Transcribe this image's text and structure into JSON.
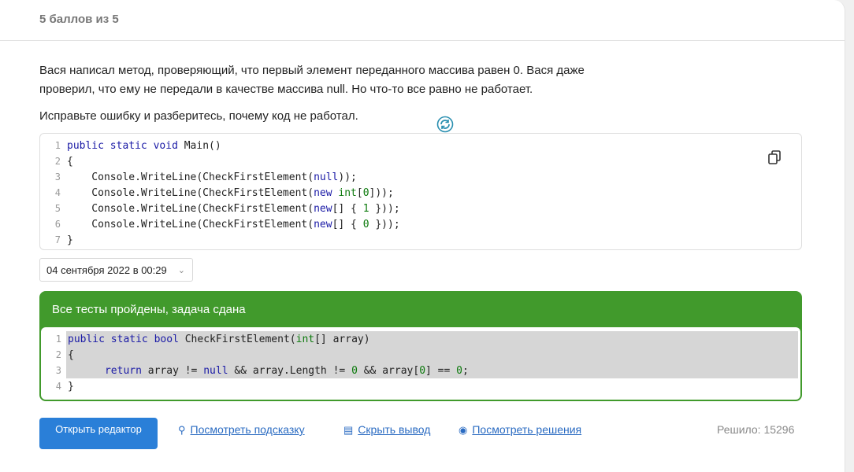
{
  "score": "5 баллов из 5",
  "task": {
    "paragraph1": "Вася написал метод, проверяющий, что первый элемент переданного массива равен 0. Вася даже проверил, что ему не передали в качестве массива null. Но что-то все равно не работает.",
    "paragraph2": "Исправьте ошибку и разберитесь, почему код не работал."
  },
  "code": {
    "line_numbers": [
      "1",
      "2",
      "3",
      "4",
      "5",
      "6",
      "7"
    ],
    "lines": [
      "public static void Main()",
      "{",
      "    Console.WriteLine(CheckFirstElement(null));",
      "    Console.WriteLine(CheckFirstElement(new int[0]));",
      "    Console.WriteLine(CheckFirstElement(new[] { 1 }));",
      "    Console.WriteLine(CheckFirstElement(new[] { 0 }));",
      "}"
    ]
  },
  "submission": {
    "date": "04 сентября 2022 в 00:29"
  },
  "result": {
    "title": "Все тесты пройдены, задача сдана",
    "line_numbers": [
      "1",
      "2",
      "3",
      "4"
    ],
    "lines": [
      "public static bool CheckFirstElement(int[] array)",
      "{",
      "      return array != null && array.Length != 0 && array[0] == 0;",
      "}"
    ]
  },
  "actions": {
    "open_editor": "Открыть редактор",
    "show_hint": "Посмотреть подсказку",
    "hide_output": "Скрыть вывод",
    "view_solutions": "Посмотреть решения",
    "solved": "Решило: 15296"
  },
  "colors": {
    "success": "#419a2c",
    "primary": "#2a7fd8",
    "keyword": "#1a1aa6",
    "type": "#0d7a0d"
  },
  "icons": [
    "spinner-icon",
    "copy-icon",
    "chevron-down-icon",
    "hint-icon",
    "output-icon",
    "eye-icon"
  ]
}
